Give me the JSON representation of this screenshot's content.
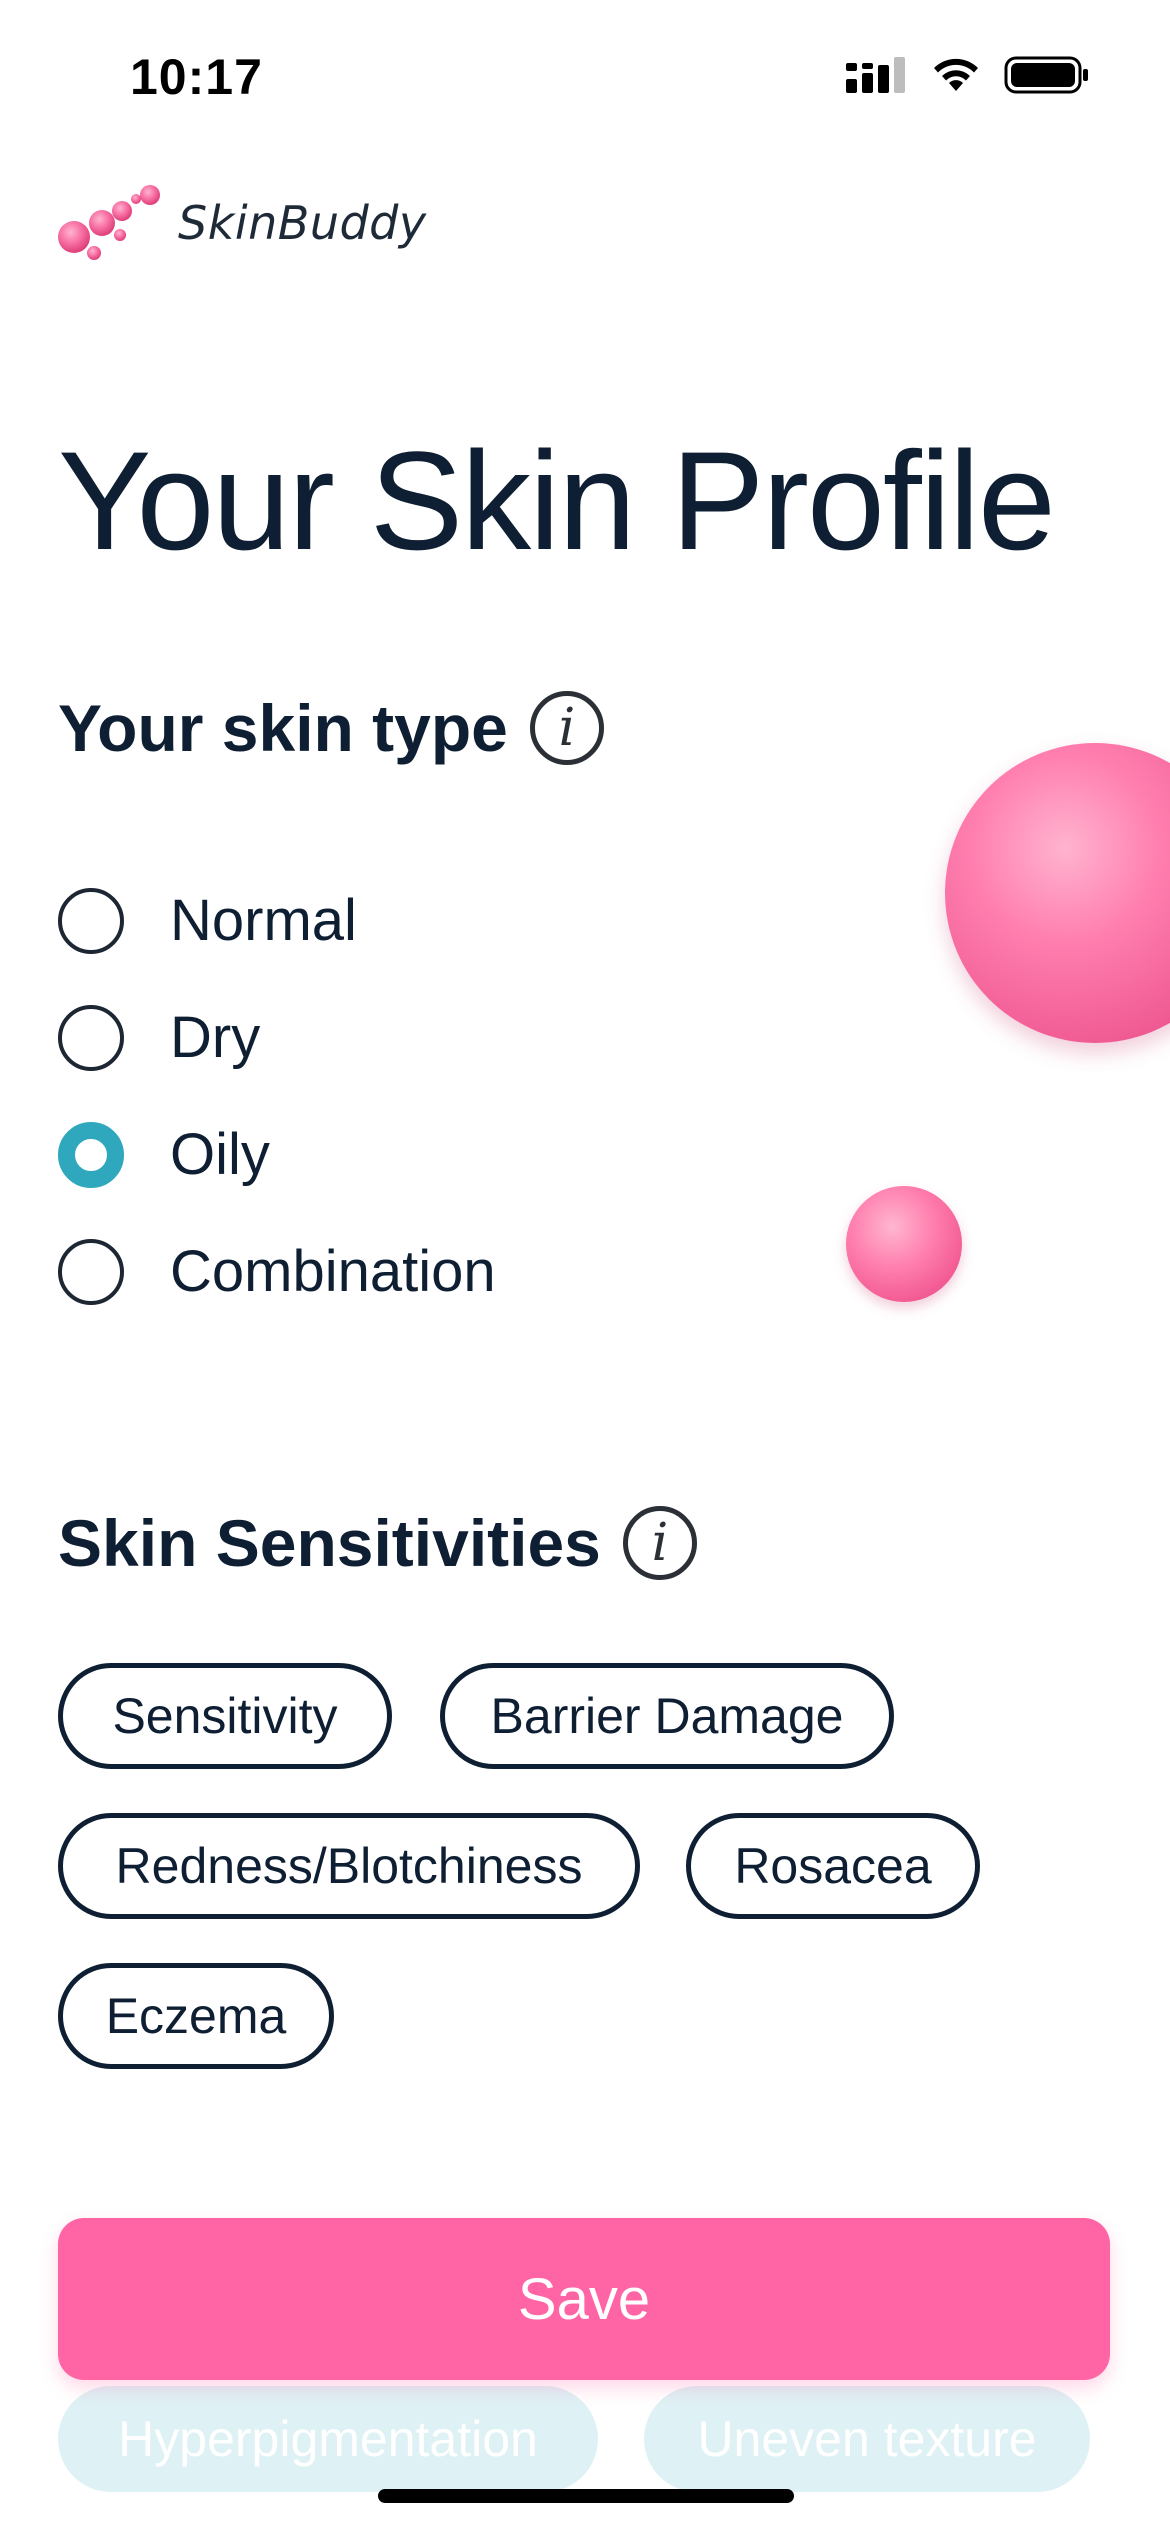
{
  "status_bar": {
    "time": "10:17",
    "icons": [
      "cellular-signal-icon",
      "wifi-icon",
      "battery-icon"
    ]
  },
  "app": {
    "name": "SkinBuddy",
    "logo_icon": "bubbles-logo-icon",
    "accent_color": "#ff64a5",
    "selected_color": "#2fa8bd"
  },
  "page": {
    "title": "Your Skin Profile"
  },
  "skin_type": {
    "title": "Your skin type",
    "info_glyph": "i",
    "options": [
      {
        "label": "Normal",
        "selected": false
      },
      {
        "label": "Dry",
        "selected": false
      },
      {
        "label": "Oily",
        "selected": true
      },
      {
        "label": "Combination",
        "selected": false
      }
    ]
  },
  "sensitivities": {
    "title": "Skin Sensitivities",
    "info_glyph": "i",
    "chips": [
      "Sensitivity",
      "Barrier Damage",
      "Redness/Blotchiness",
      "Rosacea",
      "Eczema"
    ]
  },
  "footer": {
    "save_label": "Save",
    "faded_chips": [
      "Hyperpigmentation",
      "Uneven texture"
    ]
  }
}
